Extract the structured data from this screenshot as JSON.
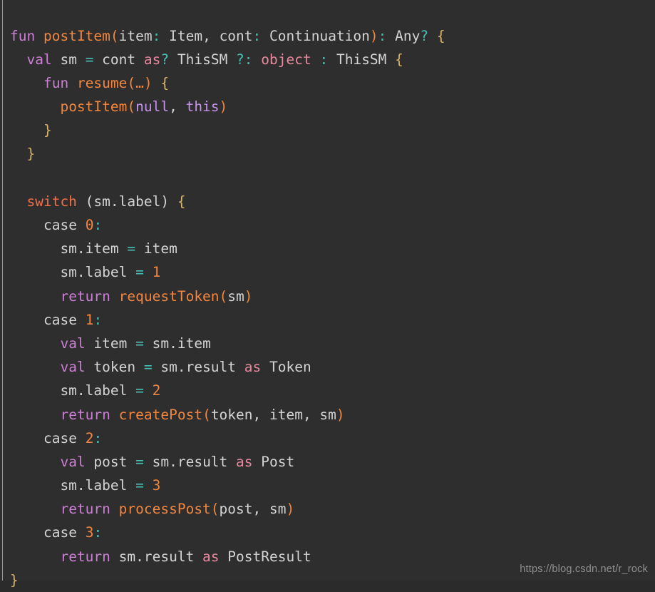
{
  "editor": {
    "language": "kotlin-pseudocode",
    "background_color": "#2e2e2e",
    "gutter_rule_color": "#9a9a9a",
    "font_size_px": 19.5,
    "line_height_px": 33.2,
    "palette": {
      "keyword": "#cc7fd4",
      "keyword_soft": "#e8899e",
      "control": "#f0704a",
      "function": "#f2863f",
      "number": "#f2863f",
      "plain": "#d4d4d4",
      "punctuation": "#46c0b4",
      "brace": "#d9b26a",
      "constant": "#c792ea",
      "watermark": "#8f8f8f"
    }
  },
  "watermark": {
    "text": "https://blog.csdn.net/r_rock"
  },
  "code": {
    "plain_text": "fun postItem(item: Item, cont: Continuation): Any? {\n  val sm = cont as? ThisSM ?: object : ThisSM {\n    fun resume(…) {\n      postItem(null, this)\n    }\n  }\n\n  switch (sm.label) {\n    case 0:\n      sm.item = item\n      sm.label = 1\n      return requestToken(sm)\n    case 1:\n      val item = sm.item\n      val token = sm.result as Token\n      sm.label = 2\n      return createPost(token, item, sm)\n    case 2:\n      val post = sm.result as Post\n      sm.label = 3\n      return processPost(post, sm)\n    case 3:\n      return sm.result as PostResult\n}",
    "lines": [
      {
        "n": 1,
        "tokens": [
          {
            "t": "fun",
            "c": "t-kw"
          },
          {
            "t": " ",
            "c": "t-plain"
          },
          {
            "t": "postItem",
            "c": "t-fn"
          },
          {
            "t": "(",
            "c": "t-paren"
          },
          {
            "t": "item",
            "c": "t-plain"
          },
          {
            "t": ":",
            "c": "t-punc"
          },
          {
            "t": " Item",
            "c": "t-type"
          },
          {
            "t": ", ",
            "c": "t-plain"
          },
          {
            "t": "cont",
            "c": "t-plain"
          },
          {
            "t": ":",
            "c": "t-punc"
          },
          {
            "t": " Continuation",
            "c": "t-type"
          },
          {
            "t": ")",
            "c": "t-paren"
          },
          {
            "t": ":",
            "c": "t-punc"
          },
          {
            "t": " Any",
            "c": "t-type"
          },
          {
            "t": "?",
            "c": "t-punc"
          },
          {
            "t": " ",
            "c": "t-plain"
          },
          {
            "t": "{",
            "c": "t-brace"
          }
        ]
      },
      {
        "n": 2,
        "tokens": [
          {
            "t": "  ",
            "c": "t-plain"
          },
          {
            "t": "val",
            "c": "t-kw"
          },
          {
            "t": " sm ",
            "c": "t-plain"
          },
          {
            "t": "=",
            "c": "t-punc"
          },
          {
            "t": " cont ",
            "c": "t-plain"
          },
          {
            "t": "as",
            "c": "t-kw2"
          },
          {
            "t": "?",
            "c": "t-punc"
          },
          {
            "t": " ThisSM ",
            "c": "t-type"
          },
          {
            "t": "?:",
            "c": "t-punc"
          },
          {
            "t": " ",
            "c": "t-plain"
          },
          {
            "t": "object",
            "c": "t-kw2"
          },
          {
            "t": " ",
            "c": "t-plain"
          },
          {
            "t": ":",
            "c": "t-punc"
          },
          {
            "t": " ThisSM ",
            "c": "t-type"
          },
          {
            "t": "{",
            "c": "t-brace"
          }
        ]
      },
      {
        "n": 3,
        "tokens": [
          {
            "t": "    ",
            "c": "t-plain"
          },
          {
            "t": "fun",
            "c": "t-kw"
          },
          {
            "t": " ",
            "c": "t-plain"
          },
          {
            "t": "resume",
            "c": "t-fn"
          },
          {
            "t": "(…)",
            "c": "t-paren"
          },
          {
            "t": " ",
            "c": "t-plain"
          },
          {
            "t": "{",
            "c": "t-brace"
          }
        ]
      },
      {
        "n": 4,
        "tokens": [
          {
            "t": "      ",
            "c": "t-plain"
          },
          {
            "t": "postItem",
            "c": "t-fn"
          },
          {
            "t": "(",
            "c": "t-paren"
          },
          {
            "t": "null",
            "c": "t-const"
          },
          {
            "t": ", ",
            "c": "t-plain"
          },
          {
            "t": "this",
            "c": "t-const"
          },
          {
            "t": ")",
            "c": "t-paren"
          }
        ]
      },
      {
        "n": 5,
        "tokens": [
          {
            "t": "    ",
            "c": "t-plain"
          },
          {
            "t": "}",
            "c": "t-brace"
          }
        ]
      },
      {
        "n": 6,
        "tokens": [
          {
            "t": "  ",
            "c": "t-plain"
          },
          {
            "t": "}",
            "c": "t-brace"
          }
        ]
      },
      {
        "n": 7,
        "tokens": []
      },
      {
        "n": 8,
        "tokens": [
          {
            "t": "  ",
            "c": "t-plain"
          },
          {
            "t": "switch",
            "c": "t-ctrl"
          },
          {
            "t": " (sm.label) ",
            "c": "t-plain"
          },
          {
            "t": "{",
            "c": "t-brace"
          }
        ]
      },
      {
        "n": 9,
        "tokens": [
          {
            "t": "    ",
            "c": "t-plain"
          },
          {
            "t": "case",
            "c": "t-case"
          },
          {
            "t": " ",
            "c": "t-plain"
          },
          {
            "t": "0",
            "c": "t-num"
          },
          {
            "t": ":",
            "c": "t-punc"
          }
        ]
      },
      {
        "n": 10,
        "tokens": [
          {
            "t": "      sm.item ",
            "c": "t-plain"
          },
          {
            "t": "=",
            "c": "t-punc"
          },
          {
            "t": " item",
            "c": "t-plain"
          }
        ]
      },
      {
        "n": 11,
        "tokens": [
          {
            "t": "      sm.label ",
            "c": "t-plain"
          },
          {
            "t": "=",
            "c": "t-punc"
          },
          {
            "t": " ",
            "c": "t-plain"
          },
          {
            "t": "1",
            "c": "t-num"
          }
        ]
      },
      {
        "n": 12,
        "tokens": [
          {
            "t": "      ",
            "c": "t-plain"
          },
          {
            "t": "return",
            "c": "t-kw"
          },
          {
            "t": " ",
            "c": "t-plain"
          },
          {
            "t": "requestToken",
            "c": "t-fn"
          },
          {
            "t": "(",
            "c": "t-paren"
          },
          {
            "t": "sm",
            "c": "t-plain"
          },
          {
            "t": ")",
            "c": "t-paren"
          }
        ]
      },
      {
        "n": 13,
        "tokens": [
          {
            "t": "    ",
            "c": "t-plain"
          },
          {
            "t": "case",
            "c": "t-case"
          },
          {
            "t": " ",
            "c": "t-plain"
          },
          {
            "t": "1",
            "c": "t-num"
          },
          {
            "t": ":",
            "c": "t-punc"
          }
        ]
      },
      {
        "n": 14,
        "tokens": [
          {
            "t": "      ",
            "c": "t-plain"
          },
          {
            "t": "val",
            "c": "t-kw"
          },
          {
            "t": " item ",
            "c": "t-plain"
          },
          {
            "t": "=",
            "c": "t-punc"
          },
          {
            "t": " sm.item",
            "c": "t-plain"
          }
        ]
      },
      {
        "n": 15,
        "tokens": [
          {
            "t": "      ",
            "c": "t-plain"
          },
          {
            "t": "val",
            "c": "t-kw"
          },
          {
            "t": " token ",
            "c": "t-plain"
          },
          {
            "t": "=",
            "c": "t-punc"
          },
          {
            "t": " sm.result ",
            "c": "t-plain"
          },
          {
            "t": "as",
            "c": "t-kw2"
          },
          {
            "t": " Token",
            "c": "t-type"
          }
        ]
      },
      {
        "n": 16,
        "tokens": [
          {
            "t": "      sm.label ",
            "c": "t-plain"
          },
          {
            "t": "=",
            "c": "t-punc"
          },
          {
            "t": " ",
            "c": "t-plain"
          },
          {
            "t": "2",
            "c": "t-num"
          }
        ]
      },
      {
        "n": 17,
        "tokens": [
          {
            "t": "      ",
            "c": "t-plain"
          },
          {
            "t": "return",
            "c": "t-kw"
          },
          {
            "t": " ",
            "c": "t-plain"
          },
          {
            "t": "createPost",
            "c": "t-fn"
          },
          {
            "t": "(",
            "c": "t-paren"
          },
          {
            "t": "token, item, sm",
            "c": "t-plain"
          },
          {
            "t": ")",
            "c": "t-paren"
          }
        ]
      },
      {
        "n": 18,
        "tokens": [
          {
            "t": "    ",
            "c": "t-plain"
          },
          {
            "t": "case",
            "c": "t-case"
          },
          {
            "t": " ",
            "c": "t-plain"
          },
          {
            "t": "2",
            "c": "t-num"
          },
          {
            "t": ":",
            "c": "t-punc"
          }
        ]
      },
      {
        "n": 19,
        "tokens": [
          {
            "t": "      ",
            "c": "t-plain"
          },
          {
            "t": "val",
            "c": "t-kw"
          },
          {
            "t": " post ",
            "c": "t-plain"
          },
          {
            "t": "=",
            "c": "t-punc"
          },
          {
            "t": " sm.result ",
            "c": "t-plain"
          },
          {
            "t": "as",
            "c": "t-kw2"
          },
          {
            "t": " Post",
            "c": "t-type"
          }
        ]
      },
      {
        "n": 20,
        "tokens": [
          {
            "t": "      sm.label ",
            "c": "t-plain"
          },
          {
            "t": "=",
            "c": "t-punc"
          },
          {
            "t": " ",
            "c": "t-plain"
          },
          {
            "t": "3",
            "c": "t-num"
          }
        ]
      },
      {
        "n": 21,
        "tokens": [
          {
            "t": "      ",
            "c": "t-plain"
          },
          {
            "t": "return",
            "c": "t-kw"
          },
          {
            "t": " ",
            "c": "t-plain"
          },
          {
            "t": "processPost",
            "c": "t-fn"
          },
          {
            "t": "(",
            "c": "t-paren"
          },
          {
            "t": "post, sm",
            "c": "t-plain"
          },
          {
            "t": ")",
            "c": "t-paren"
          }
        ]
      },
      {
        "n": 22,
        "tokens": [
          {
            "t": "    ",
            "c": "t-plain"
          },
          {
            "t": "case",
            "c": "t-case"
          },
          {
            "t": " ",
            "c": "t-plain"
          },
          {
            "t": "3",
            "c": "t-num"
          },
          {
            "t": ":",
            "c": "t-punc"
          }
        ]
      },
      {
        "n": 23,
        "tokens": [
          {
            "t": "      ",
            "c": "t-plain"
          },
          {
            "t": "return",
            "c": "t-kw"
          },
          {
            "t": " sm.result ",
            "c": "t-plain"
          },
          {
            "t": "as",
            "c": "t-kw2"
          },
          {
            "t": " PostResult",
            "c": "t-type"
          }
        ]
      },
      {
        "n": 24,
        "tokens": [
          {
            "t": "}",
            "c": "t-brace"
          }
        ]
      }
    ]
  }
}
